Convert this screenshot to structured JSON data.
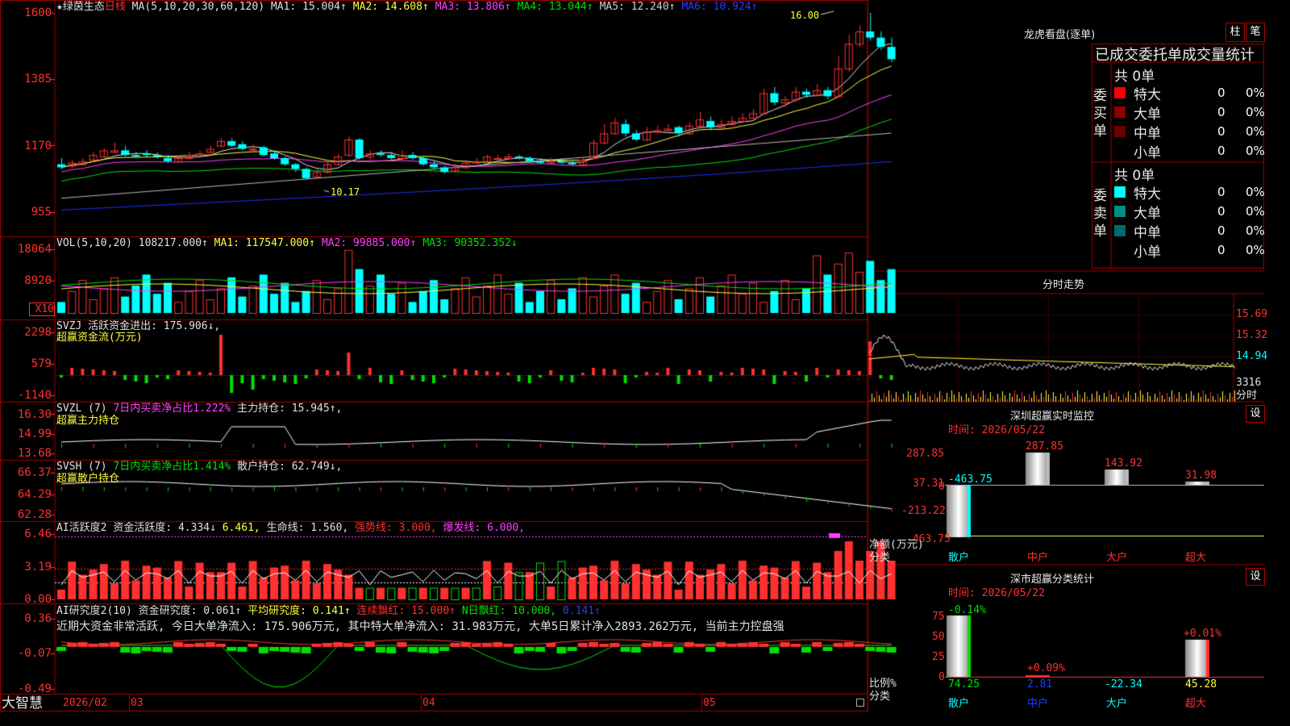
{
  "brand": "大智慧",
  "stock": {
    "name": "★绿茵生态",
    "period": "日线"
  },
  "main_legend": {
    "label": "MA(5,10,20,30,60,120)",
    "items": [
      {
        "text": "MA1: 15.004↑",
        "color": "#e0e0e0"
      },
      {
        "text": "MA2: 14.608↑",
        "color": "#ffff3c"
      },
      {
        "text": "MA3: 13.806↑",
        "color": "#ff40ff"
      },
      {
        "text": "MA4: 13.044↑",
        "color": "#00e000"
      },
      {
        "text": "MA5: 12.240↑",
        "color": "#cfcfcf"
      },
      {
        "text": "MA6: 10.924↑",
        "color": "#2040ff"
      }
    ]
  },
  "vol_legend": {
    "label": "VOL(5,10,20)",
    "value": "108217.000↑",
    "items": [
      {
        "text": "MA1: 117547.000↑",
        "color": "#ffff3c"
      },
      {
        "text": "MA2: 99885.000↑",
        "color": "#ff40ff"
      },
      {
        "text": "MA3: 90352.352↓",
        "color": "#00e000"
      }
    ]
  },
  "svzj_legend": {
    "label": "SVZJ",
    "text": "活跃资金进出: 175.906↓,",
    "sub": "超赢资金流(万元)"
  },
  "svzl_legend": {
    "label": "SVZL (7)",
    "t1": "7日内买卖净占比1.222%",
    "t2": "主力持仓: 15.945↑,",
    "sub": "超赢主力持仓"
  },
  "svsh_legend": {
    "label": "SVSH (7)",
    "t1": "7日内买卖净占比1.414%",
    "t2": "散户持仓: 62.749↓,",
    "sub": "超赢散户持仓"
  },
  "ai1_legend": {
    "label": "AI活跃度2",
    "t1": "资金活跃度: 4.334↓",
    "t2": "6.461,",
    "t3": "生命线: 1.560,",
    "t4": "强势线: 3.000,",
    "t5": "爆发线: 6.000,"
  },
  "ai2_legend": {
    "label": "AI研究度2(10)",
    "t1": "资金研究度: 0.061↑",
    "t2": "平均研究度: 0.141↑",
    "t3": "连续飘红: 15.000↑",
    "t4": "N日飘红: 10.000,",
    "t5": "0.141↑",
    "note": "近期大资金非常活跃, 今日大单净流入: 175.906万元, 其中特大单净流入: 31.983万元, 大单5日累计净入2893.262万元, 当前主力控盘强"
  },
  "y_labels": {
    "main": [
      "1600",
      "1385",
      "1170",
      "955"
    ],
    "vol": [
      "18064",
      "8920",
      "X10"
    ],
    "svzj": [
      "2298",
      "579",
      "-1140"
    ],
    "svzl": [
      "16.30",
      "14.99",
      "13.68"
    ],
    "svsh": [
      "66.37",
      "64.29",
      "62.28"
    ],
    "ai1": [
      "6.46",
      "3.19",
      "0.00"
    ],
    "ai2": [
      "0.36",
      "-0.07",
      "-0.49"
    ]
  },
  "x_labels": [
    "2026/02",
    "03",
    "04",
    "05"
  ],
  "annotations": {
    "high": "16.00",
    "low": "10.17"
  },
  "dragon": {
    "title": "龙虎看盘(逐单)",
    "btn1": "柱",
    "btn2": "笔",
    "header": "已成交委托单成交量统计",
    "buy_label": "委买单",
    "sell_label": "委卖单",
    "buy_total": "共 0单",
    "sell_total": "共 0单",
    "rows": [
      {
        "name": "特大",
        "count": "0",
        "pct": "0%"
      },
      {
        "name": "大单",
        "count": "0",
        "pct": "0%"
      },
      {
        "name": "中单",
        "count": "0",
        "pct": "0%"
      },
      {
        "name": "小单",
        "count": "0",
        "pct": "0%"
      }
    ]
  },
  "minute": {
    "title": "分时走势",
    "y": [
      "15.69",
      "15.32",
      "14.94"
    ],
    "vol": "3316",
    "unit": "分时"
  },
  "sz_monitor": {
    "title": "深圳超赢实时监控",
    "btn": "设",
    "time": "时间: 2026/05/22",
    "y": [
      "287.85",
      "37.31",
      "0",
      "-213.22",
      "-463.75"
    ],
    "side1": "净额(万元)",
    "side2": "分类",
    "cats": [
      "散户",
      "中户",
      "大户",
      "超大"
    ],
    "values": [
      "-463.75",
      "287.85",
      "143.92",
      "31.98"
    ]
  },
  "sz_class": {
    "title": "深市超赢分类统计",
    "btn": "设",
    "time": "时间: 2026/05/22",
    "y": [
      "75",
      "50",
      "25",
      "0"
    ],
    "side1": "比例%",
    "side2": "分类",
    "cats": [
      "散户",
      "中户",
      "大户",
      "超大"
    ],
    "top": [
      "-0.14%",
      "+0.09%",
      "",
      "+0.01%"
    ],
    "values": [
      "74.25",
      "2.81",
      "-22.34",
      "45.28"
    ]
  },
  "chart_data": {
    "type": "candlestick",
    "title": "★绿茵生态 日线",
    "x": [
      "2026/02",
      "03",
      "04",
      "05"
    ],
    "ylim": [
      955,
      1600
    ],
    "candles": [
      [
        11.1,
        11.0,
        11.3,
        10.95
      ],
      [
        11.05,
        11.15,
        11.25,
        10.98
      ],
      [
        11.1,
        11.2,
        11.3,
        11.05
      ],
      [
        11.25,
        11.4,
        11.5,
        11.2
      ],
      [
        11.35,
        11.55,
        11.62,
        11.3
      ],
      [
        11.5,
        11.55,
        11.8,
        11.45
      ],
      [
        11.55,
        11.4,
        11.7,
        11.35
      ],
      [
        11.4,
        11.35,
        11.5,
        11.3
      ],
      [
        11.45,
        11.4,
        11.55,
        11.3
      ],
      [
        11.4,
        11.35,
        11.48,
        11.28
      ],
      [
        11.3,
        11.2,
        11.4,
        11.15
      ],
      [
        11.2,
        11.3,
        11.35,
        11.15
      ],
      [
        11.3,
        11.4,
        11.5,
        11.25
      ],
      [
        11.4,
        11.45,
        11.55,
        11.35
      ],
      [
        11.5,
        11.6,
        11.7,
        11.45
      ],
      [
        11.7,
        11.85,
        11.95,
        11.65
      ],
      [
        11.85,
        11.7,
        11.95,
        11.65
      ],
      [
        11.75,
        11.6,
        11.85,
        11.55
      ],
      [
        11.6,
        11.6,
        11.75,
        11.5
      ],
      [
        11.65,
        11.4,
        11.7,
        11.35
      ],
      [
        11.45,
        11.3,
        11.55,
        11.25
      ],
      [
        11.3,
        11.1,
        11.35,
        11.05
      ],
      [
        11.1,
        10.95,
        11.15,
        10.85
      ],
      [
        10.95,
        10.65,
        11.0,
        10.6
      ],
      [
        10.7,
        10.85,
        10.95,
        10.62
      ],
      [
        10.85,
        11.1,
        11.25,
        10.8
      ],
      [
        11.1,
        11.35,
        11.45,
        11.05
      ],
      [
        11.4,
        11.9,
        12.0,
        11.35
      ],
      [
        11.9,
        11.3,
        11.95,
        11.25
      ],
      [
        11.35,
        11.45,
        11.55,
        11.25
      ],
      [
        11.45,
        11.4,
        11.55,
        11.35
      ],
      [
        11.4,
        11.3,
        11.5,
        11.25
      ],
      [
        11.3,
        11.4,
        11.55,
        11.28
      ],
      [
        11.4,
        11.3,
        11.5,
        11.25
      ],
      [
        11.3,
        11.1,
        11.35,
        11.05
      ],
      [
        11.1,
        11.0,
        11.2,
        10.95
      ],
      [
        11.0,
        10.85,
        11.05,
        10.8
      ],
      [
        10.9,
        11.0,
        11.1,
        10.85
      ],
      [
        11.0,
        11.15,
        11.25,
        10.95
      ],
      [
        11.15,
        11.2,
        11.3,
        11.1
      ],
      [
        11.2,
        11.35,
        11.4,
        11.15
      ],
      [
        11.3,
        11.3,
        11.4,
        11.2
      ],
      [
        11.3,
        11.35,
        11.45,
        11.25
      ],
      [
        11.35,
        11.3,
        11.4,
        11.25
      ],
      [
        11.3,
        11.2,
        11.35,
        11.15
      ],
      [
        11.2,
        11.15,
        11.3,
        11.1
      ],
      [
        11.15,
        11.2,
        11.3,
        11.1
      ],
      [
        11.2,
        11.15,
        11.3,
        11.1
      ],
      [
        11.15,
        11.1,
        11.25,
        11.05
      ],
      [
        11.1,
        11.25,
        11.35,
        11.05
      ],
      [
        11.3,
        11.8,
        11.9,
        11.25
      ],
      [
        11.8,
        12.1,
        12.4,
        11.75
      ],
      [
        12.1,
        12.45,
        12.6,
        12.05
      ],
      [
        12.4,
        12.1,
        12.55,
        12.0
      ],
      [
        12.1,
        11.9,
        12.2,
        11.85
      ],
      [
        11.9,
        12.15,
        12.3,
        11.85
      ],
      [
        12.15,
        12.2,
        12.35,
        12.1
      ],
      [
        12.2,
        12.25,
        12.4,
        12.15
      ],
      [
        12.3,
        12.1,
        12.35,
        12.0
      ],
      [
        12.1,
        12.35,
        12.45,
        12.05
      ],
      [
        12.35,
        12.55,
        12.8,
        12.3
      ],
      [
        12.5,
        12.3,
        12.65,
        12.2
      ],
      [
        12.3,
        12.4,
        12.55,
        12.25
      ],
      [
        12.4,
        12.5,
        12.65,
        12.35
      ],
      [
        12.5,
        12.6,
        12.75,
        12.45
      ],
      [
        12.6,
        12.75,
        12.9,
        12.55
      ],
      [
        12.75,
        13.4,
        13.55,
        12.7
      ],
      [
        13.4,
        13.1,
        13.6,
        13.0
      ],
      [
        13.1,
        13.2,
        13.3,
        12.95
      ],
      [
        13.2,
        13.45,
        13.6,
        13.1
      ],
      [
        13.45,
        13.35,
        13.55,
        13.25
      ],
      [
        13.35,
        13.5,
        13.7,
        13.3
      ],
      [
        13.5,
        13.3,
        13.6,
        13.2
      ],
      [
        13.3,
        14.2,
        14.6,
        13.25
      ],
      [
        14.2,
        15.0,
        15.3,
        14.1
      ],
      [
        15.0,
        15.4,
        15.6,
        14.9
      ],
      [
        15.4,
        15.2,
        16.0,
        15.1
      ],
      [
        15.2,
        14.9,
        15.4,
        14.8
      ],
      [
        14.9,
        14.5,
        15.2,
        14.4
      ]
    ]
  }
}
